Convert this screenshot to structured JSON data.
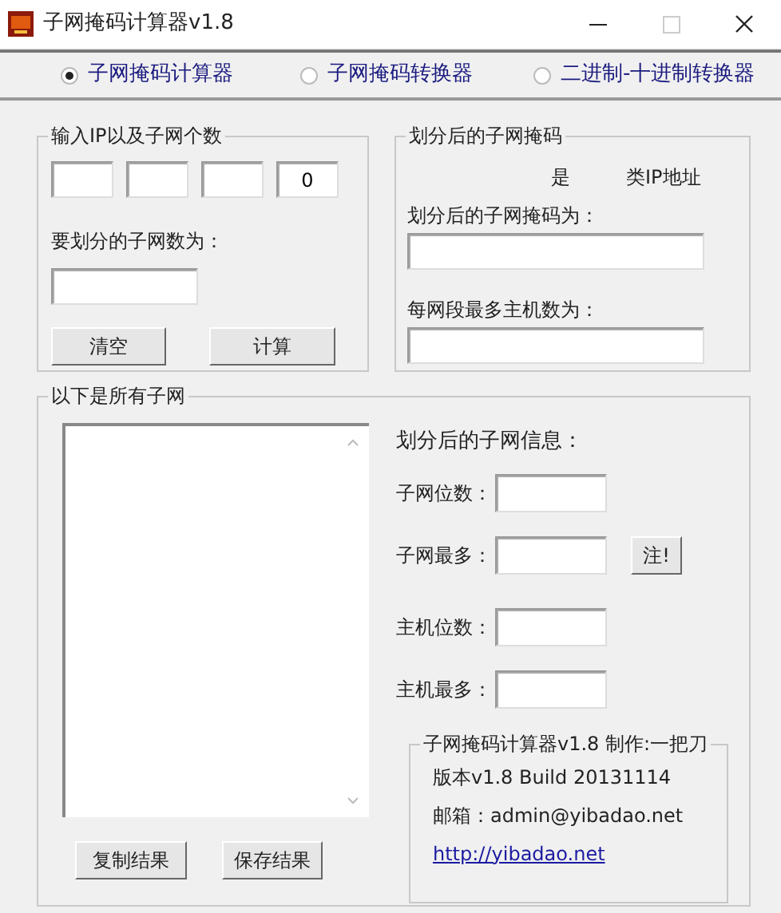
{
  "window": {
    "title": "子网掩码计算器v1.8"
  },
  "modes": [
    {
      "label": "子网掩码计算器",
      "selected": true
    },
    {
      "label": "子网掩码转换器",
      "selected": false
    },
    {
      "label": "二进制-十进制转换器",
      "selected": false
    }
  ],
  "ip_group": {
    "title": "输入IP以及子网个数",
    "last_octet_value": "0",
    "subnet_count_label": "要划分的子网数为：",
    "buttons": [
      "清空",
      "计算"
    ]
  },
  "mask_group": {
    "title": "划分后的子网掩码",
    "class_prefix": "是",
    "class_suffix": "类IP地址",
    "mask_label": "划分后的子网掩码为：",
    "hosts_label": "每网段最多主机数为："
  },
  "subnets_group": {
    "title": "以下是所有子网",
    "info_title": "划分后的子网信息：",
    "fields": [
      {
        "label": "子网位数：",
        "kind": "plain"
      },
      {
        "label": "子网最多：",
        "kind": "note",
        "button": "注!"
      },
      {
        "label": "主机位数：",
        "kind": "plain"
      },
      {
        "label": "主机最多：",
        "kind": "plain"
      }
    ],
    "buttons": [
      "复制结果",
      "保存结果"
    ],
    "about": {
      "title": "子网掩码计算器v1.8  制作:一把刀",
      "version": "版本v1.8  Build 20131114",
      "email": "邮箱：admin@yibadao.net",
      "link": "http://yibadao.net"
    }
  }
}
